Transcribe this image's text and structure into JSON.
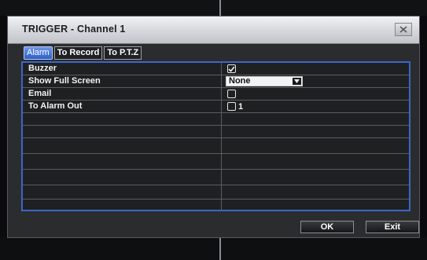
{
  "dialog": {
    "title": "TRIGGER - Channel 1",
    "close_icon": "close-x-icon"
  },
  "tabs": [
    {
      "label": "Alarm",
      "active": true
    },
    {
      "label": "To Record",
      "active": false
    },
    {
      "label": "To P.T.Z",
      "active": false
    }
  ],
  "rows": [
    {
      "label": "Buzzer",
      "control": "checkbox",
      "checked": true
    },
    {
      "label": "Show Full Screen",
      "control": "select",
      "value": "None"
    },
    {
      "label": "Email",
      "control": "checkbox",
      "checked": false
    },
    {
      "label": "To Alarm Out",
      "control": "checkbox",
      "checked": false,
      "suffix": "1"
    }
  ],
  "buttons": {
    "ok": "OK",
    "exit": "Exit"
  },
  "colors": {
    "tab_active": "#3f6fd6",
    "table_border": "#3c66c8"
  }
}
